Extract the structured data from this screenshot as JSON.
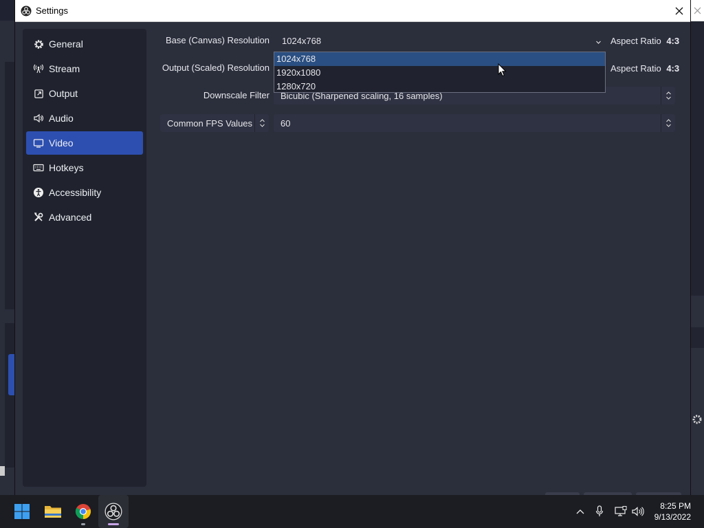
{
  "window": {
    "title": "Settings"
  },
  "sidebar": {
    "items": [
      {
        "label": "General",
        "icon": "gear-icon",
        "active": false
      },
      {
        "label": "Stream",
        "icon": "broadcast-icon",
        "active": false
      },
      {
        "label": "Output",
        "icon": "output-icon",
        "active": false
      },
      {
        "label": "Audio",
        "icon": "speaker-icon",
        "active": false
      },
      {
        "label": "Video",
        "icon": "monitor-icon",
        "active": true
      },
      {
        "label": "Hotkeys",
        "icon": "keyboard-icon",
        "active": false
      },
      {
        "label": "Accessibility",
        "icon": "accessibility-icon",
        "active": false
      },
      {
        "label": "Advanced",
        "icon": "tools-icon",
        "active": false
      }
    ]
  },
  "video": {
    "base_label": "Base (Canvas) Resolution",
    "base_value": "1024x768",
    "base_aspect_prefix": "Aspect Ratio",
    "base_aspect_value": "4:3",
    "output_label": "Output (Scaled) Resolution",
    "output_aspect_prefix": "Aspect Ratio",
    "output_aspect_value": "4:3",
    "downscale_label": "Downscale Filter",
    "downscale_value": "Bicubic (Sharpened scaling, 16 samples)",
    "fps_type": "Common FPS Values",
    "fps_value": "60"
  },
  "dropdown": {
    "options": [
      "1024x768",
      "1920x1080",
      "1280x720"
    ],
    "highlighted": "1024x768"
  },
  "taskbar": {
    "time": "8:25 PM",
    "date": "9/13/2022"
  },
  "colors": {
    "accent": "#2d4fb0",
    "highlight": "#2a4f82",
    "window_bg": "#2b2e3b",
    "sidebar_bg": "#20232e"
  }
}
